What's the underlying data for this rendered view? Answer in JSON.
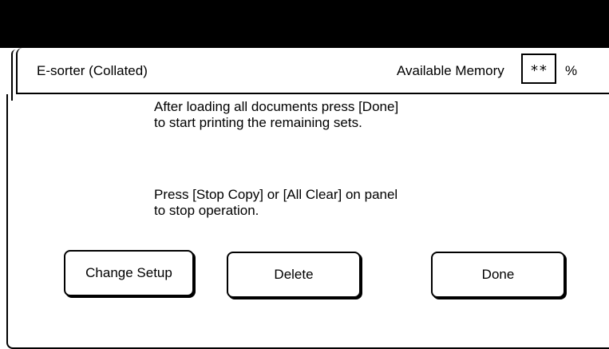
{
  "header": {
    "title": "E-sorter (Collated)",
    "memory_label": "Available Memory",
    "memory_value": "**",
    "memory_unit": "%"
  },
  "message": {
    "line1": "After loading all documents press [Done]",
    "line2": "to start printing the remaining sets.",
    "line3": "Press [Stop Copy] or [All Clear] on panel",
    "line4": "to stop operation."
  },
  "buttons": {
    "change_setup": "Change Setup",
    "delete": "Delete",
    "done": "Done"
  }
}
